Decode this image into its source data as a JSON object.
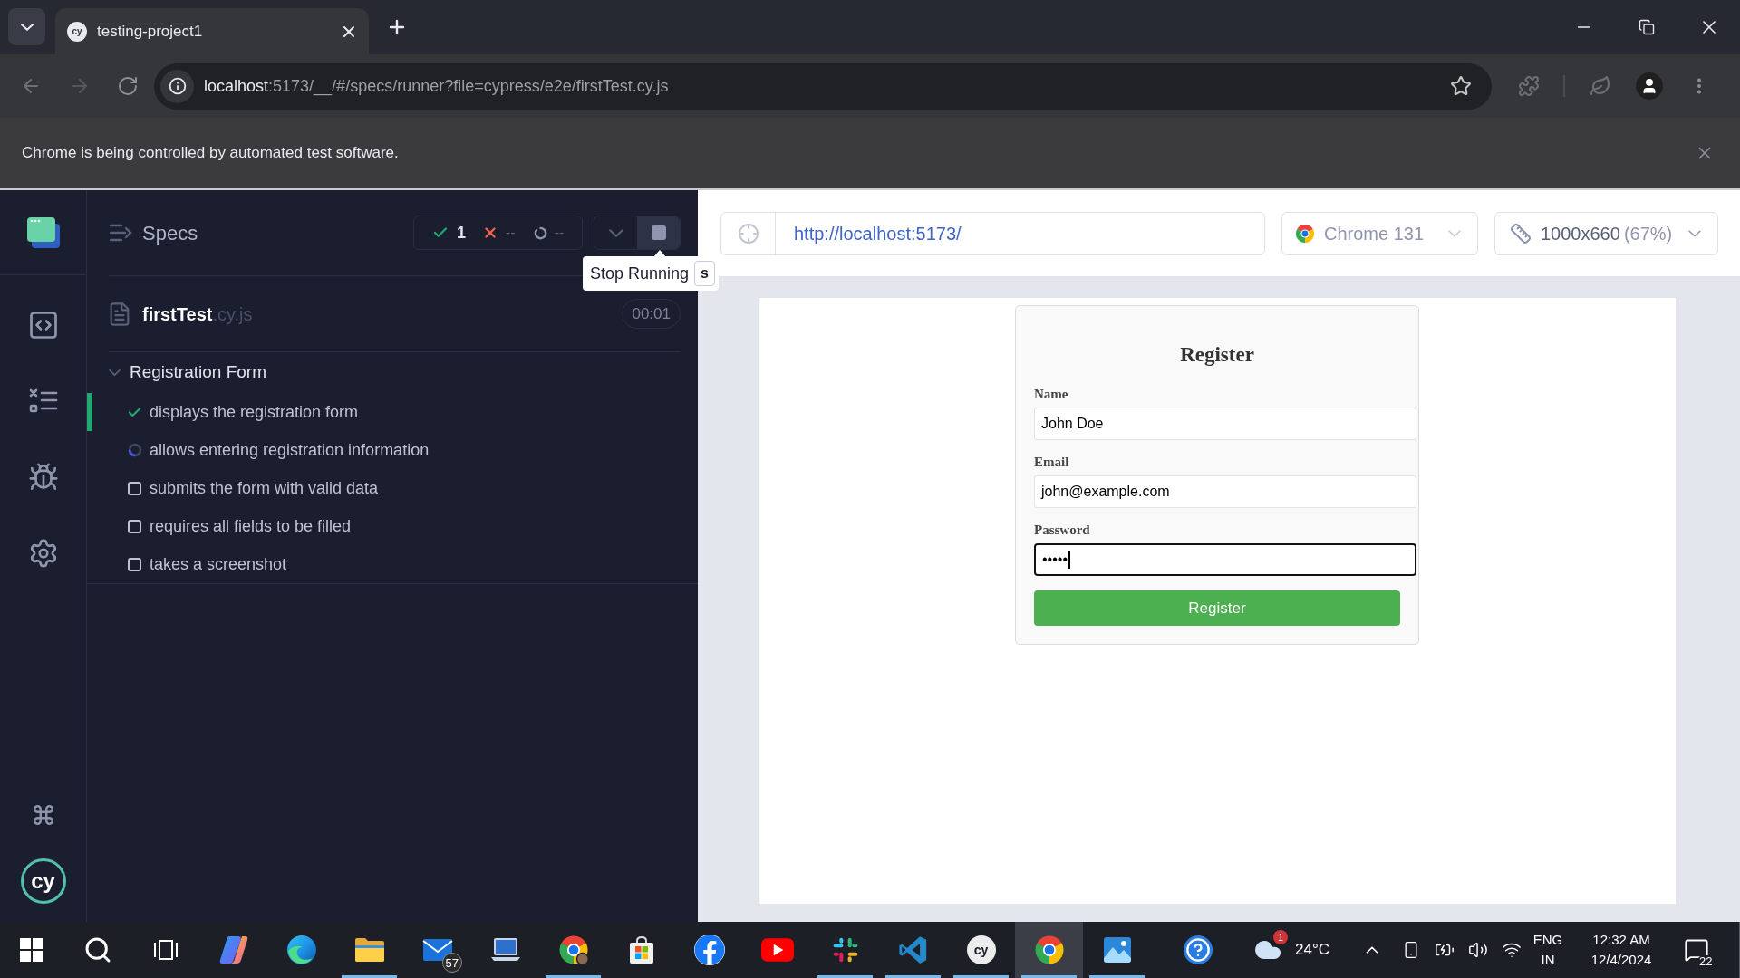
{
  "browser": {
    "tabs": [
      {
        "title": "testing-project1",
        "favicon": "cy",
        "selected": true
      }
    ],
    "address_bar": {
      "host": "localhost",
      "path": ":5173/__/#/specs/runner?file=cypress/e2e/firstTest.cy.js"
    },
    "infobar": {
      "message": "Chrome is being controlled by automated test software."
    }
  },
  "runner": {
    "logo": "cy",
    "specs_header": {
      "title": "Specs"
    },
    "stats": {
      "passed": "1",
      "failed": "--",
      "pending": "--"
    },
    "tooltip": {
      "label": "Stop Running",
      "shortcut": "s"
    },
    "spec": {
      "name": "firstTest",
      "extension": ".cy.js",
      "duration": "00:01"
    },
    "suite": {
      "title": "Registration Form",
      "expanded": true,
      "tests": [
        {
          "title": "displays the registration form",
          "kind": "passed",
          "selected": true
        },
        {
          "title": "allows entering registration information",
          "kind": "running",
          "selected": false
        },
        {
          "title": "submits the form with valid data",
          "kind": "pending",
          "selected": false
        },
        {
          "title": "requires all fields to be filled",
          "kind": "pending",
          "selected": false
        },
        {
          "title": "takes a screenshot",
          "kind": "pending",
          "selected": false
        }
      ]
    }
  },
  "preview": {
    "url": "http://localhost:5173/",
    "browser": "Chrome 131",
    "viewport": {
      "size": "1000x660",
      "scale": "(67%)"
    },
    "form": {
      "title": "Register",
      "fields": [
        {
          "label": "Name",
          "value": "John Doe",
          "focused": false
        },
        {
          "label": "Email",
          "value": "john@example.com",
          "focused": false
        },
        {
          "label": "Password",
          "value": "•••••",
          "focused": true
        }
      ],
      "submit": "Register"
    }
  },
  "taskbar": {
    "apps": [
      {
        "kind": "start",
        "running": false,
        "selected": false
      },
      {
        "kind": "search",
        "running": false,
        "selected": false
      },
      {
        "kind": "task-view",
        "running": false,
        "selected": false
      },
      {
        "kind": "copilot",
        "running": false,
        "selected": false
      },
      {
        "kind": "edge",
        "running": false,
        "selected": false
      },
      {
        "kind": "files",
        "running": true,
        "selected": false
      },
      {
        "kind": "mail",
        "badge": "57",
        "running": false,
        "selected": false
      },
      {
        "kind": "laptop",
        "running": false,
        "selected": false
      },
      {
        "kind": "chrome-profile",
        "running": true,
        "selected": false
      },
      {
        "kind": "store",
        "running": false,
        "selected": false
      },
      {
        "kind": "facebook",
        "running": false,
        "selected": false
      },
      {
        "kind": "youtube",
        "running": false,
        "selected": false
      },
      {
        "kind": "slack",
        "running": true,
        "selected": false
      },
      {
        "kind": "vscode",
        "running": true,
        "selected": false
      },
      {
        "kind": "cypress",
        "label": "cy",
        "running": true,
        "selected": false
      },
      {
        "kind": "chrome",
        "running": true,
        "selected": true
      },
      {
        "kind": "photos",
        "running": true,
        "selected": false
      }
    ],
    "weather": {
      "temperature": "24°C",
      "badge": "1"
    },
    "language": {
      "code": "ENG",
      "region": "IN"
    },
    "clock": {
      "time": "12:32 AM",
      "date": "12/4/2024"
    },
    "notifications": {
      "count": "22"
    }
  }
}
